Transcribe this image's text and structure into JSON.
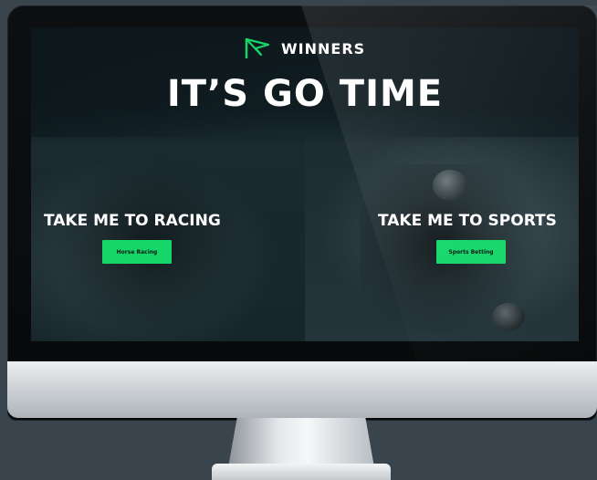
{
  "brand": {
    "name": "WINNERS",
    "icon": "flag-icon",
    "accent_color": "#16d66a"
  },
  "hero": {
    "title": "IT’S GO TIME"
  },
  "racing": {
    "heading": "TAKE ME TO RACING",
    "button_label": "Horse Racing"
  },
  "sports": {
    "heading": "TAKE ME TO SPORTS",
    "button_label": "Sports Betting"
  }
}
